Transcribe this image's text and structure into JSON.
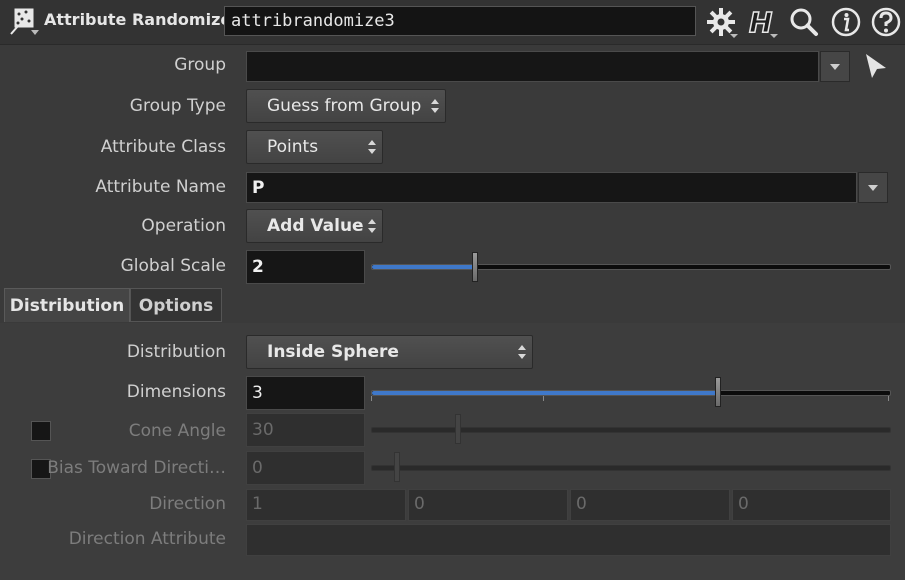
{
  "header": {
    "node_type": "Attribute Randomize",
    "node_name": "attribrandomize3",
    "icons": [
      "attribrandomize-node-icon",
      "gear-icon",
      "houdini-h-icon",
      "search-icon",
      "info-icon",
      "help-icon"
    ]
  },
  "params": {
    "group": {
      "label": "Group",
      "value": ""
    },
    "group_type": {
      "label": "Group Type",
      "value": "Guess from Group"
    },
    "attribute_class": {
      "label": "Attribute Class",
      "value": "Points"
    },
    "attribute_name": {
      "label": "Attribute Name",
      "value": "P"
    },
    "operation": {
      "label": "Operation",
      "value": "Add Value"
    },
    "global_scale": {
      "label": "Global Scale",
      "value": "2",
      "slider_fraction": 0.2
    }
  },
  "tabs": [
    {
      "label": "Distribution",
      "active": true
    },
    {
      "label": "Options",
      "active": false
    }
  ],
  "distribution": {
    "distribution": {
      "label": "Distribution",
      "value": "Inside Sphere"
    },
    "dimensions": {
      "label": "Dimensions",
      "value": "3",
      "slider_fraction": 0.67
    },
    "cone_angle": {
      "label": "Cone Angle",
      "value": "30",
      "enabled": false,
      "slider_fraction": 0.167
    },
    "bias_toward_direction": {
      "label": "Bias Toward Directi…",
      "value": "0",
      "enabled": false,
      "slider_fraction": 0.05
    },
    "direction": {
      "label": "Direction",
      "values": [
        "1",
        "0",
        "0",
        "0"
      ]
    },
    "direction_attribute": {
      "label": "Direction Attribute",
      "value": ""
    }
  },
  "colors": {
    "accent_blue": "#3f78c9",
    "background": "#3a3a3a",
    "field_bg": "#161616"
  }
}
